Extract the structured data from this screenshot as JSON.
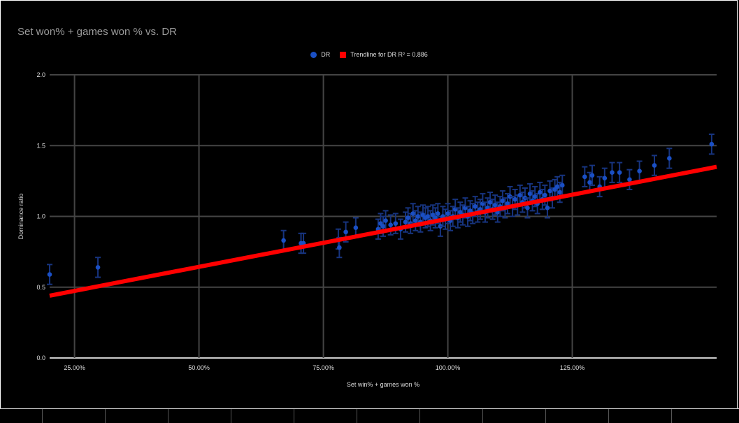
{
  "chart_data": {
    "type": "scatter",
    "title": "Set won% + games won % vs. DR",
    "xlabel": "Set win% + games won %",
    "ylabel": "Dominance ratio",
    "xlim": [
      0.2,
      1.54
    ],
    "ylim": [
      0,
      2.0
    ],
    "x_ticks": [
      0.25,
      0.5,
      0.75,
      1.0,
      1.25
    ],
    "x_tick_labels": [
      "25.00%",
      "50.00%",
      "75.00%",
      "100.00%",
      "125.00%"
    ],
    "y_ticks": [
      0,
      0.5,
      1.0,
      1.5,
      2.0
    ],
    "y_tick_labels": [
      "0.0",
      "0.5",
      "1.0",
      "1.5",
      "2.0"
    ],
    "grid": true,
    "legend_position": "top",
    "legend": [
      "DR",
      "Trendline for DR R² = 0.886"
    ],
    "colors": {
      "series": "#1a4fc4",
      "errorbar": "#17347f",
      "trend": "#ff0000",
      "grid": "#444444",
      "background": "#000000"
    },
    "series": [
      {
        "name": "DR",
        "error": 0.07,
        "points": [
          [
            0.2,
            0.59
          ],
          [
            0.297,
            0.64
          ],
          [
            0.67,
            0.83
          ],
          [
            0.705,
            0.81
          ],
          [
            0.71,
            0.81
          ],
          [
            0.78,
            0.84
          ],
          [
            0.782,
            0.78
          ],
          [
            0.795,
            0.89
          ],
          [
            0.815,
            0.92
          ],
          [
            0.86,
            0.91
          ],
          [
            0.865,
            0.95
          ],
          [
            0.87,
            0.93
          ],
          [
            0.875,
            0.97
          ],
          [
            0.885,
            0.94
          ],
          [
            0.895,
            0.95
          ],
          [
            0.905,
            0.91
          ],
          [
            0.915,
            0.96
          ],
          [
            0.92,
            0.99
          ],
          [
            0.925,
            0.95
          ],
          [
            0.93,
            1.02
          ],
          [
            0.935,
            0.97
          ],
          [
            0.94,
            1.0
          ],
          [
            0.945,
            0.96
          ],
          [
            0.95,
            1.01
          ],
          [
            0.955,
            0.99
          ],
          [
            0.96,
            1.0
          ],
          [
            0.965,
            0.97
          ],
          [
            0.97,
            1.01
          ],
          [
            0.975,
            0.99
          ],
          [
            0.98,
            1.02
          ],
          [
            0.985,
            0.93
          ],
          [
            0.99,
            1.0
          ],
          [
            0.995,
            0.98
          ],
          [
            1.0,
            1.02
          ],
          [
            1.005,
            0.97
          ],
          [
            1.01,
            1.0
          ],
          [
            1.015,
            1.05
          ],
          [
            1.02,
            0.99
          ],
          [
            1.025,
            1.03
          ],
          [
            1.03,
            1.01
          ],
          [
            1.035,
            1.06
          ],
          [
            1.04,
            1.0
          ],
          [
            1.045,
            1.04
          ],
          [
            1.05,
            1.02
          ],
          [
            1.055,
            1.07
          ],
          [
            1.06,
            1.03
          ],
          [
            1.065,
            1.05
          ],
          [
            1.07,
            1.09
          ],
          [
            1.075,
            1.03
          ],
          [
            1.08,
            1.06
          ],
          [
            1.085,
            1.1
          ],
          [
            1.09,
            1.05
          ],
          [
            1.095,
            1.08
          ],
          [
            1.1,
            1.03
          ],
          [
            1.105,
            1.07
          ],
          [
            1.11,
            1.11
          ],
          [
            1.115,
            1.06
          ],
          [
            1.12,
            1.09
          ],
          [
            1.125,
            1.14
          ],
          [
            1.13,
            1.07
          ],
          [
            1.135,
            1.12
          ],
          [
            1.14,
            1.08
          ],
          [
            1.145,
            1.15
          ],
          [
            1.15,
            1.1
          ],
          [
            1.155,
            1.13
          ],
          [
            1.16,
            1.06
          ],
          [
            1.165,
            1.16
          ],
          [
            1.17,
            1.11
          ],
          [
            1.175,
            1.14
          ],
          [
            1.18,
            1.09
          ],
          [
            1.185,
            1.17
          ],
          [
            1.19,
            1.12
          ],
          [
            1.195,
            1.15
          ],
          [
            1.2,
            1.06
          ],
          [
            1.205,
            1.18
          ],
          [
            1.21,
            1.13
          ],
          [
            1.215,
            1.19
          ],
          [
            1.22,
            1.21
          ],
          [
            1.225,
            1.17
          ],
          [
            1.23,
            1.22
          ],
          [
            1.275,
            1.28
          ],
          [
            1.285,
            1.24
          ],
          [
            1.29,
            1.29
          ],
          [
            1.305,
            1.21
          ],
          [
            1.315,
            1.27
          ],
          [
            1.33,
            1.31
          ],
          [
            1.345,
            1.31
          ],
          [
            1.365,
            1.26
          ],
          [
            1.385,
            1.32
          ],
          [
            1.415,
            1.36
          ],
          [
            1.445,
            1.41
          ],
          [
            1.53,
            1.51
          ]
        ]
      },
      {
        "name": "Trendline for DR R² = 0.886",
        "type": "line",
        "x": [
          0.2,
          1.54
        ],
        "y": [
          0.44,
          1.35
        ]
      }
    ]
  }
}
